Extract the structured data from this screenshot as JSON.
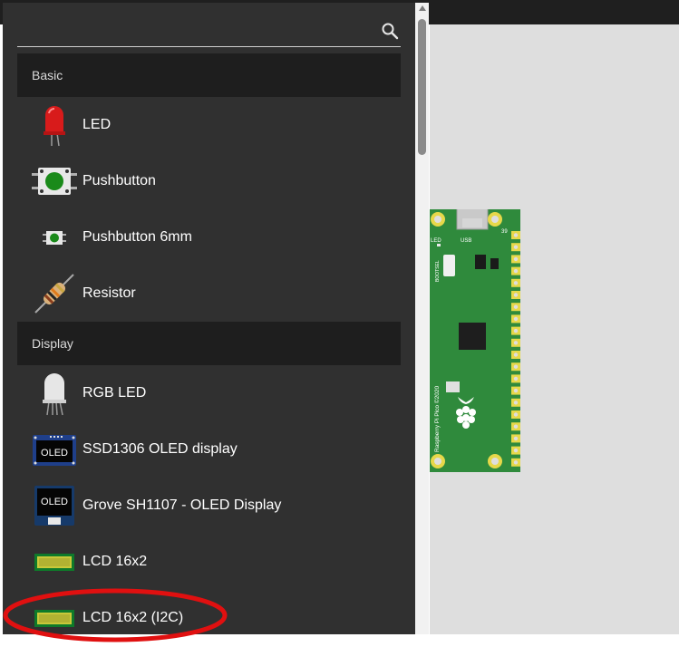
{
  "search": {
    "placeholder": "",
    "value": ""
  },
  "sections": [
    {
      "title": "Basic",
      "items": [
        {
          "label": "LED",
          "icon": "red-led-icon"
        },
        {
          "label": "Pushbutton",
          "icon": "pushbutton-icon"
        },
        {
          "label": "Pushbutton 6mm",
          "icon": "pushbutton-6mm-icon"
        },
        {
          "label": "Resistor",
          "icon": "resistor-icon"
        }
      ]
    },
    {
      "title": "Display",
      "items": [
        {
          "label": "RGB LED",
          "icon": "rgb-led-icon"
        },
        {
          "label": "SSD1306 OLED display",
          "icon": "oled-icon",
          "icon_text": "OLED"
        },
        {
          "label": "Grove SH1107 - OLED Display",
          "icon": "grove-oled-icon",
          "icon_text": "OLED"
        },
        {
          "label": "LCD 16x2",
          "icon": "lcd-icon"
        },
        {
          "label": "LCD 16x2 (I2C)",
          "icon": "lcd-i2c-icon"
        }
      ]
    }
  ],
  "board": {
    "name": "Raspberry Pi Pico",
    "silkscreen": "Raspberry Pi Pico ©2020",
    "led_label": "LED",
    "usb_label": "USB",
    "bootsel_label": "BOOTSEL",
    "pin_label": "39"
  },
  "colors": {
    "panel_bg": "#303030",
    "section_bg": "#1e1e1e",
    "board_green": "#2f8a3c",
    "annotation_red": "#e01010"
  }
}
